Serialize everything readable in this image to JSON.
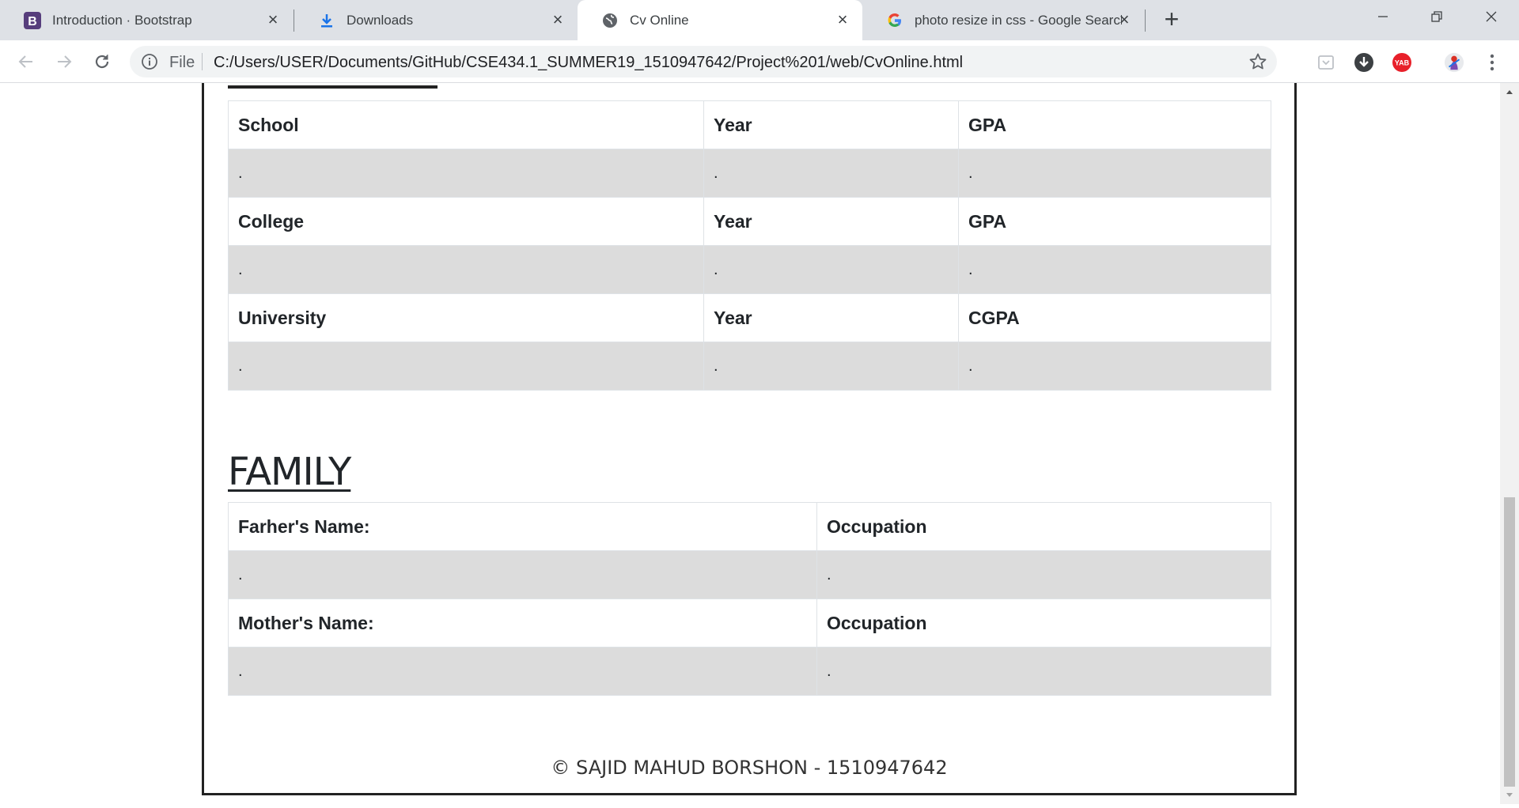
{
  "browser": {
    "tabs": [
      {
        "title": "Introduction · Bootstrap",
        "icon": "bootstrap-icon",
        "active": false
      },
      {
        "title": "Downloads",
        "icon": "download-icon",
        "active": false
      },
      {
        "title": "Cv Online",
        "icon": "globe-icon",
        "active": true
      },
      {
        "title": "photo resize in css - Google Search",
        "icon": "google-icon",
        "active": false
      }
    ],
    "address": {
      "scheme_label": "File",
      "url": "C:/Users/USER/Documents/GitHub/CSE434.1_SUMMER19_1510947642/Project%201/web/CvOnline.html"
    },
    "extension_badge": "YAB"
  },
  "education": {
    "rows": [
      {
        "header": [
          "School",
          "Year",
          "GPA"
        ],
        "values": [
          ".",
          ".",
          "."
        ]
      },
      {
        "header": [
          "College",
          "Year",
          "GPA"
        ],
        "values": [
          ".",
          ".",
          "."
        ]
      },
      {
        "header": [
          "University",
          "Year",
          "CGPA"
        ],
        "values": [
          ".",
          ".",
          "."
        ]
      }
    ]
  },
  "family": {
    "title": "FAMILY",
    "rows": [
      {
        "header": [
          "Farher's Name:",
          "Occupation"
        ],
        "values": [
          ".",
          "."
        ]
      },
      {
        "header": [
          "Mother's Name:",
          "Occupation"
        ],
        "values": [
          ".",
          "."
        ]
      }
    ]
  },
  "footer": {
    "text": "© SAJID MAHUD BORSHON - 1510947642"
  }
}
